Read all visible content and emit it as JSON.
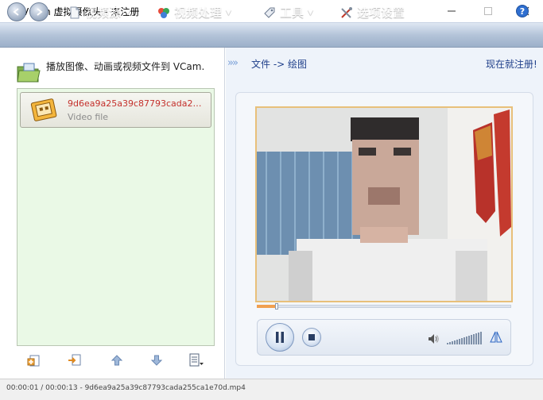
{
  "window": {
    "title": "VCam 虚拟摄像头 - 未注册"
  },
  "menu": {
    "source_label": "视频源",
    "process_label": "视频处理",
    "tools_label": "工具",
    "options_label": "选项设置"
  },
  "left_panel": {
    "header": "播放图像、动画或视频文件到 VCam.",
    "items": [
      {
        "name": "9d6ea9a25a39c87793cada255c...",
        "type": "Video file"
      }
    ]
  },
  "right_panel": {
    "breadcrumb": "文件 -> 绘图",
    "register_link": "现在就注册!"
  },
  "player": {
    "progress_fraction": 0.077,
    "volume_level": 1.0,
    "state": "playing"
  },
  "status": {
    "text": "00:00:01 / 00:00:13 - 9d6ea9a25a39c87793cada255ca1e70d.mp4"
  },
  "icons": {
    "app": "webcam-icon",
    "folder": "folder-icon",
    "file": "film-file-icon",
    "help": "help-icon"
  }
}
